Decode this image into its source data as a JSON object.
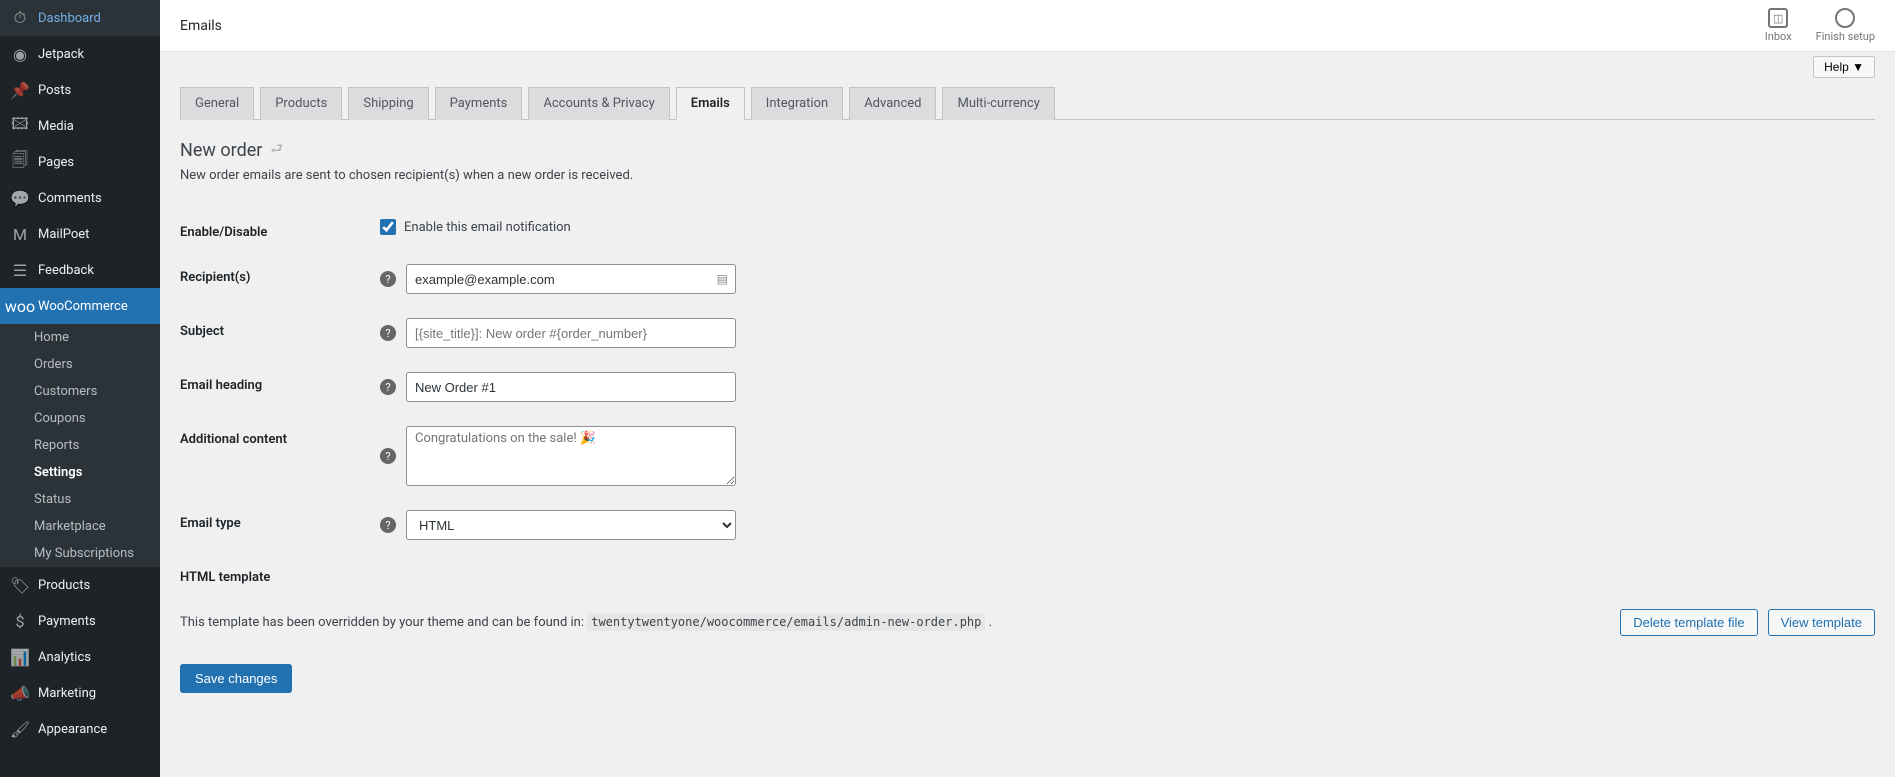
{
  "sidebar": {
    "items": [
      {
        "label": "Dashboard",
        "icon": "⏱"
      },
      {
        "label": "Jetpack",
        "icon": "◉"
      },
      {
        "label": "Posts",
        "icon": "📌"
      },
      {
        "label": "Media",
        "icon": "🖾"
      },
      {
        "label": "Pages",
        "icon": "🗐"
      },
      {
        "label": "Comments",
        "icon": "💬"
      },
      {
        "label": "MailPoet",
        "icon": "M"
      },
      {
        "label": "Feedback",
        "icon": "☰"
      },
      {
        "label": "WooCommerce",
        "icon": "woo",
        "active": true
      },
      {
        "label": "Products",
        "icon": "🏷"
      },
      {
        "label": "Payments",
        "icon": "$"
      },
      {
        "label": "Analytics",
        "icon": "📊"
      },
      {
        "label": "Marketing",
        "icon": "📣"
      },
      {
        "label": "Appearance",
        "icon": "🖌"
      }
    ],
    "woo_submenu": [
      {
        "label": "Home"
      },
      {
        "label": "Orders"
      },
      {
        "label": "Customers"
      },
      {
        "label": "Coupons"
      },
      {
        "label": "Reports"
      },
      {
        "label": "Settings",
        "active": true
      },
      {
        "label": "Status"
      },
      {
        "label": "Marketplace"
      },
      {
        "label": "My Subscriptions"
      }
    ]
  },
  "topbar": {
    "title": "Emails",
    "inbox": "Inbox",
    "finish": "Finish setup",
    "help": "Help ▼"
  },
  "tabs": [
    {
      "label": "General"
    },
    {
      "label": "Products"
    },
    {
      "label": "Shipping"
    },
    {
      "label": "Payments"
    },
    {
      "label": "Accounts & Privacy"
    },
    {
      "label": "Emails",
      "active": true
    },
    {
      "label": "Integration"
    },
    {
      "label": "Advanced"
    },
    {
      "label": "Multi-currency"
    }
  ],
  "section": {
    "title": "New order",
    "desc": "New order emails are sent to chosen recipient(s) when a new order is received."
  },
  "form": {
    "enable_label": "Enable/Disable",
    "enable_checkbox": "Enable this email notification",
    "recipient_label": "Recipient(s)",
    "recipient_value": "example@example.com",
    "subject_label": "Subject",
    "subject_placeholder": "[{site_title}]: New order #{order_number}",
    "heading_label": "Email heading",
    "heading_value": "New Order #1",
    "additional_label": "Additional content",
    "additional_placeholder": "Congratulations on the sale! 🎉",
    "type_label": "Email type",
    "type_value": "HTML"
  },
  "template": {
    "heading": "HTML template",
    "text": "This template has been overridden by your theme and can be found in: ",
    "path": "twentytwentyone/woocommerce/emails/admin-new-order.php",
    "suffix": " .",
    "delete": "Delete template file",
    "view": "View template"
  },
  "save": "Save changes"
}
